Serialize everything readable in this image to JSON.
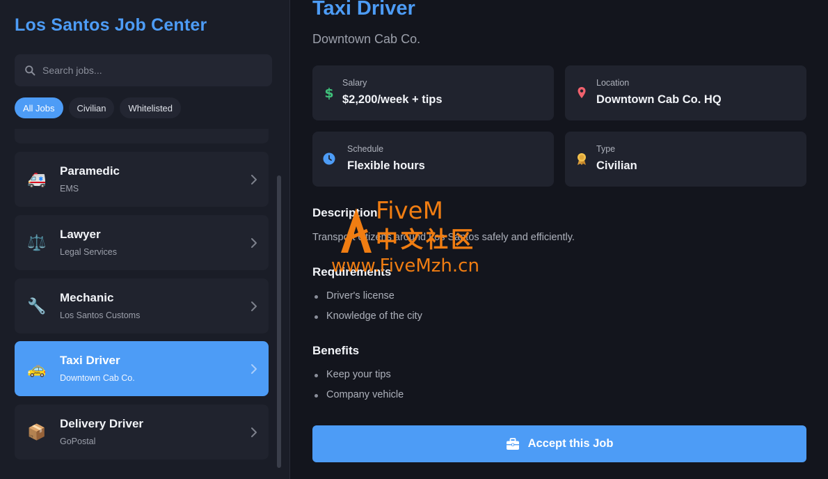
{
  "sidebar": {
    "title": "Los Santos Job Center",
    "search": {
      "placeholder": "Search jobs...",
      "value": ""
    },
    "filters": [
      {
        "label": "All Jobs",
        "active": true
      },
      {
        "label": "Civilian",
        "active": false
      },
      {
        "label": "Whitelisted",
        "active": false
      }
    ],
    "jobs": [
      {
        "title": "Paramedic",
        "subtitle": "EMS",
        "icon": "ambulance-icon",
        "selected": false
      },
      {
        "title": "Lawyer",
        "subtitle": "Legal Services",
        "icon": "scales-icon",
        "selected": false
      },
      {
        "title": "Mechanic",
        "subtitle": "Los Santos Customs",
        "icon": "wrench-icon",
        "selected": false
      },
      {
        "title": "Taxi Driver",
        "subtitle": "Downtown Cab Co.",
        "icon": "taxi-icon",
        "selected": true
      },
      {
        "title": "Delivery Driver",
        "subtitle": "GoPostal",
        "icon": "package-icon",
        "selected": false
      }
    ]
  },
  "detail": {
    "title": "Taxi Driver",
    "company": "Downtown Cab Co.",
    "info": {
      "salary": {
        "label": "Salary",
        "value": "$2,200/week + tips",
        "icon": "dollar-icon"
      },
      "location": {
        "label": "Location",
        "value": "Downtown Cab Co. HQ",
        "icon": "map-pin-icon"
      },
      "schedule": {
        "label": "Schedule",
        "value": "Flexible hours",
        "icon": "clock-icon"
      },
      "type": {
        "label": "Type",
        "value": "Civilian",
        "icon": "badge-icon"
      }
    },
    "description_title": "Description",
    "description": "Transport citizens around Los Santos safely and efficiently.",
    "requirements_title": "Requirements",
    "requirements": [
      "Driver's license",
      "Knowledge of the city"
    ],
    "benefits_title": "Benefits",
    "benefits": [
      "Keep your tips",
      "Company vehicle"
    ],
    "accept_label": "Accept this Job"
  },
  "watermark": {
    "line1": "FiveM",
    "line2": "中文社区",
    "line3": "www.FiveMzh.cn"
  },
  "colors": {
    "accent": "#4d9cf6",
    "watermark": "#f07d12"
  }
}
